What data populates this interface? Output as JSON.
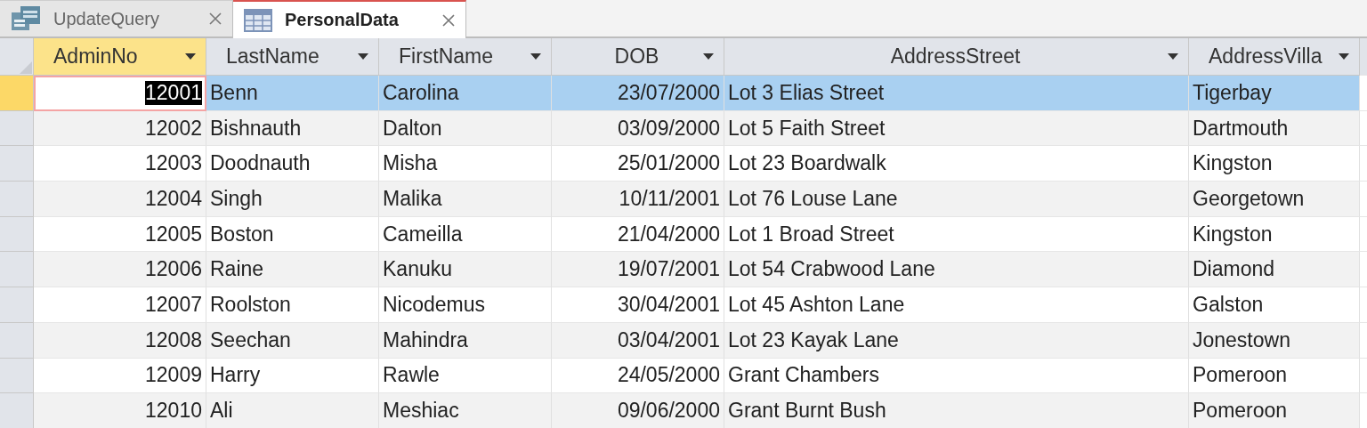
{
  "tabs": [
    {
      "label": "UpdateQuery",
      "kind": "query",
      "selected": false
    },
    {
      "label": "PersonalData",
      "kind": "table",
      "selected": true
    }
  ],
  "table": {
    "columns": [
      {
        "label": "AdminNo",
        "kind": "number",
        "selected": true
      },
      {
        "label": "LastName",
        "kind": "text",
        "selected": false
      },
      {
        "label": "FirstName",
        "kind": "text",
        "selected": false
      },
      {
        "label": "DOB",
        "kind": "date",
        "selected": false
      },
      {
        "label": "AddressStreet",
        "kind": "wide",
        "selected": false
      },
      {
        "label": "AddressVilla",
        "kind": "text",
        "selected": false
      }
    ],
    "rows": [
      {
        "selected": true,
        "cells": [
          "12001",
          "Benn",
          "Carolina",
          "23/07/2000",
          "Lot 3 Elias Street",
          "Tigerbay"
        ]
      },
      {
        "selected": false,
        "cells": [
          "12002",
          "Bishnauth",
          "Dalton",
          "03/09/2000",
          "Lot 5 Faith Street",
          "Dartmouth"
        ]
      },
      {
        "selected": false,
        "cells": [
          "12003",
          "Doodnauth",
          "Misha",
          "25/01/2000",
          "Lot 23 Boardwalk",
          "Kingston"
        ]
      },
      {
        "selected": false,
        "cells": [
          "12004",
          "Singh",
          "Malika",
          "10/11/2001",
          "Lot 76 Louse Lane",
          "Georgetown"
        ]
      },
      {
        "selected": false,
        "cells": [
          "12005",
          "Boston",
          "Cameilla",
          "21/04/2000",
          "Lot 1 Broad Street",
          "Kingston"
        ]
      },
      {
        "selected": false,
        "cells": [
          "12006",
          "Raine",
          "Kanuku",
          "19/07/2001",
          "Lot 54 Crabwood Lane",
          "Diamond"
        ]
      },
      {
        "selected": false,
        "cells": [
          "12007",
          "Roolston",
          "Nicodemus",
          "30/04/2001",
          "Lot 45 Ashton Lane",
          "Galston"
        ]
      },
      {
        "selected": false,
        "cells": [
          "12008",
          "Seechan",
          "Mahindra",
          "03/04/2001",
          "Lot 23 Kayak Lane",
          "Jonestown"
        ]
      },
      {
        "selected": false,
        "cells": [
          "12009",
          "Harry",
          "Rawle",
          "24/05/2000",
          "Grant Chambers",
          "Pomeroon"
        ]
      },
      {
        "selected": false,
        "cells": [
          "12010",
          "Ali",
          "Meshiac",
          "09/06/2000",
          "Grant Burnt Bush",
          "Pomeroon"
        ]
      }
    ]
  }
}
